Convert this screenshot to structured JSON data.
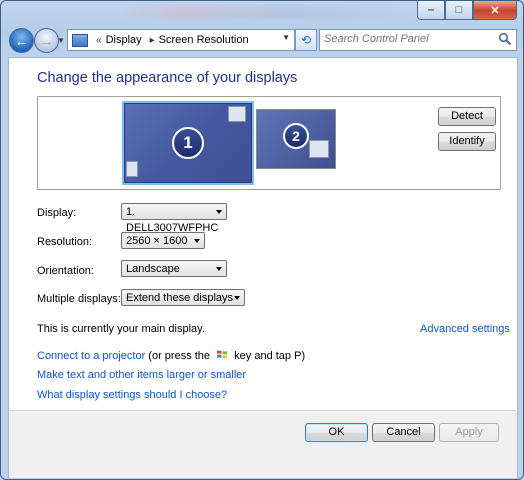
{
  "address": {
    "crumb_chevrons": "«",
    "path": [
      "Display",
      "Screen Resolution"
    ]
  },
  "search": {
    "placeholder": "Search Control Panel"
  },
  "heading": "Change the appearance of your displays",
  "preview": {
    "monitor1_number": "1",
    "monitor2_number": "2",
    "detect_label": "Detect",
    "identify_label": "Identify"
  },
  "settings": {
    "display_label": "Display:",
    "display_value": "1. DELL3007WFPHC",
    "resolution_label": "Resolution:",
    "resolution_value": "2560 × 1600",
    "orientation_label": "Orientation:",
    "orientation_value": "Landscape",
    "multiple_label": "Multiple displays:",
    "multiple_value": "Extend these displays"
  },
  "main_display_note": "This is currently your main display.",
  "advanced_link": "Advanced settings",
  "links": {
    "projector_link": "Connect to a projector",
    "projector_hint_before": "(or press the",
    "projector_hint_after": "key and tap P)",
    "text_size_link": "Make text and other items larger or smaller",
    "choose_link": "What display settings should I choose?"
  },
  "buttons": {
    "ok": "OK",
    "cancel": "Cancel",
    "apply": "Apply"
  },
  "colors": {
    "link": "#0c54c4",
    "heading": "#1e3287",
    "monitor": "#4659a0"
  }
}
